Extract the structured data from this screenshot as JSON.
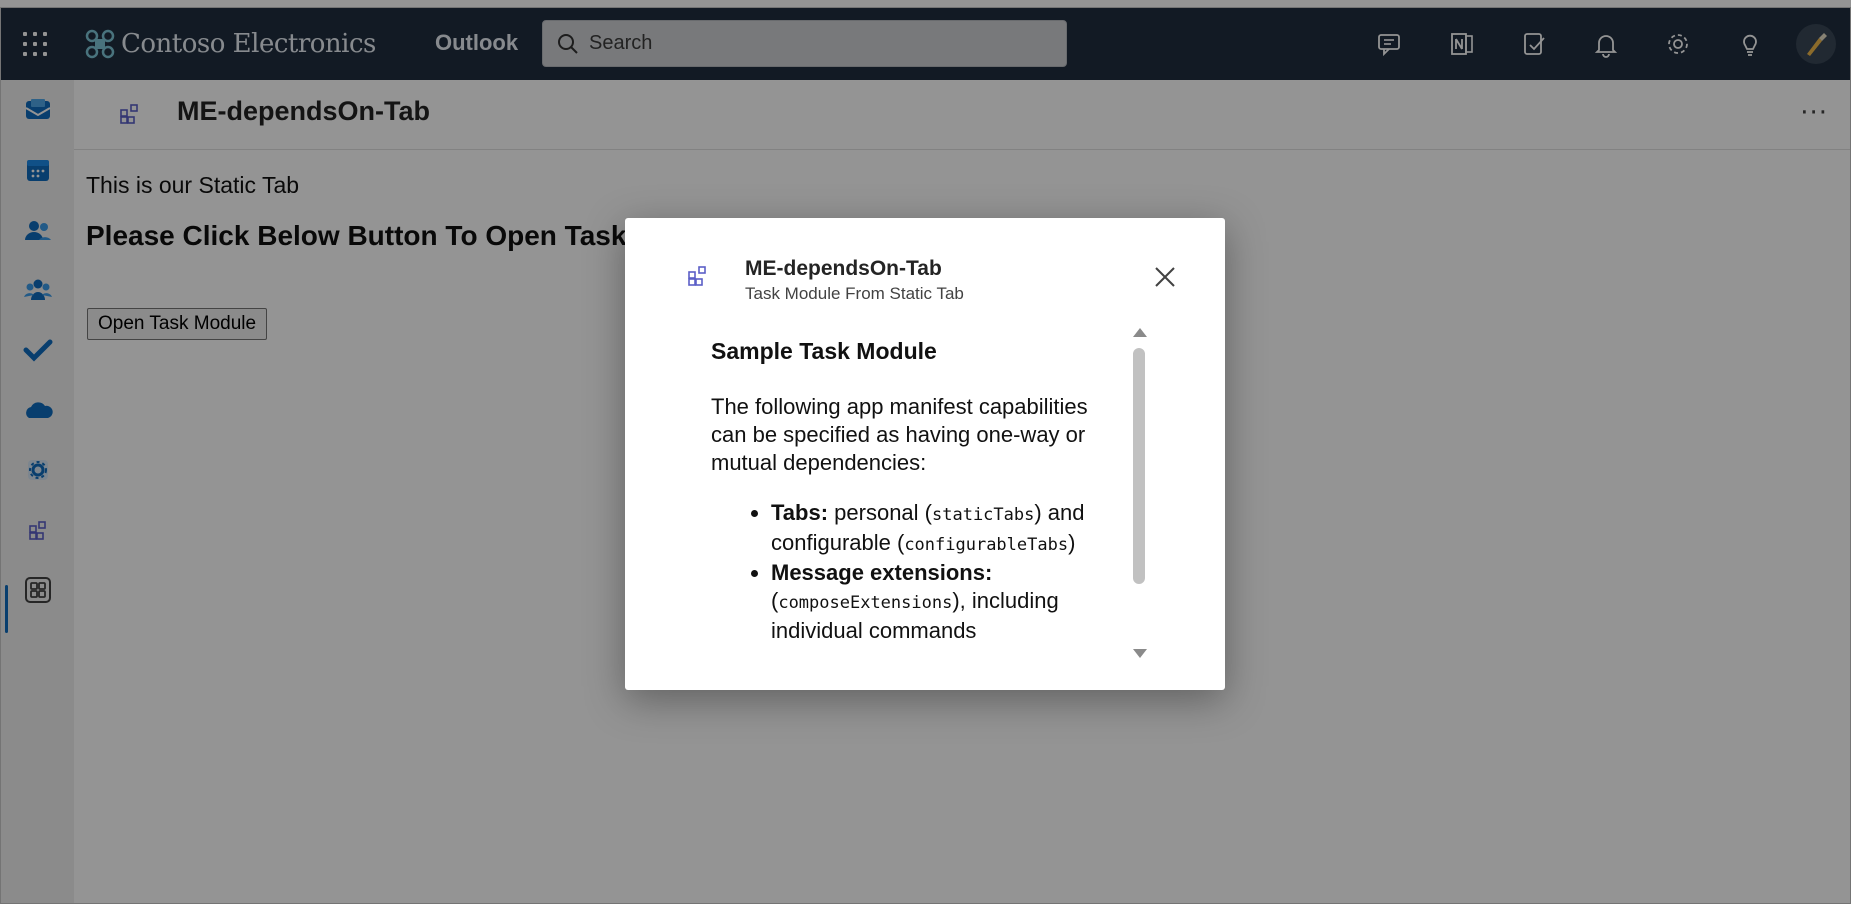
{
  "header": {
    "brand": "Contoso Electronics",
    "app": "Outlook",
    "search_placeholder": "Search",
    "icons": [
      "teams-chat-icon",
      "onenote-icon",
      "todo-icon",
      "bell-icon",
      "gear-icon",
      "lightbulb-icon",
      "avatar"
    ]
  },
  "rail": {
    "items": [
      "mail-icon",
      "calendar-icon",
      "people-icon",
      "groups-icon",
      "todo-check-icon",
      "onedrive-cloud-icon",
      "app-gear-icon",
      "custom-app-icon",
      "more-apps-icon"
    ],
    "active": "custom-app-icon"
  },
  "tab": {
    "title": "ME-dependsOn-Tab",
    "more": "···",
    "static_text": "This is our Static Tab",
    "heading": "Please Click Below Button To Open Task Module",
    "button": "Open Task Module"
  },
  "dialog": {
    "title": "ME-dependsOn-Tab",
    "subtitle": "Task Module From Static Tab",
    "heading": "Sample Task Module",
    "paragraph": "The following app manifest capabilities can be specified as having one-way or mutual dependencies:",
    "bullets": [
      {
        "label": "Tabs:",
        "pre": " personal (",
        "code1": "staticTabs",
        "mid": ") and configurable (",
        "code2": "configurableTabs",
        "post": ")"
      },
      {
        "label": "Message extensions:",
        "pre": " (",
        "code1": "composeExtensions",
        "mid": "), including individual commands",
        "code2": "",
        "post": ""
      }
    ]
  },
  "colors": {
    "topbar": "#1f2e3f",
    "accent": "#0f6cbd",
    "app_icon": "#5b5fc7"
  }
}
